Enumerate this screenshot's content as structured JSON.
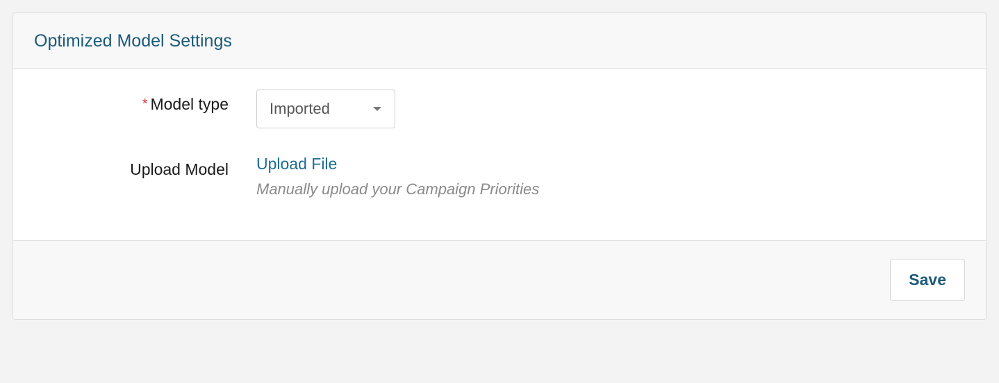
{
  "panel": {
    "title": "Optimized Model Settings"
  },
  "form": {
    "model_type": {
      "label": "Model type",
      "required_mark": "*",
      "selected": "Imported"
    },
    "upload_model": {
      "label": "Upload Model",
      "action": "Upload File",
      "help": "Manually upload your Campaign Priorities"
    }
  },
  "footer": {
    "save_label": "Save"
  }
}
